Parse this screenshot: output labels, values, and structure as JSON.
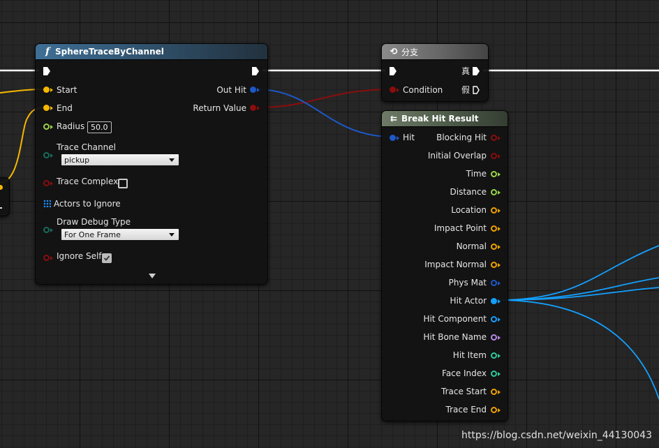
{
  "colors": {
    "exec": "#ffffff",
    "vector": "#f5b800",
    "float": "#9ad34a",
    "bool": "#8b0d0d",
    "struct": "#1e58c8",
    "enum": "#1a6b5c",
    "object": "#14a0ff",
    "name": "#b988e8",
    "teal": "#2ec99a",
    "transform": "#f0a000"
  },
  "sphere_trace": {
    "title": "SphereTraceByChannel",
    "title_icon": "function-icon",
    "pins": {
      "start": "Start",
      "end": "End",
      "radius": "Radius",
      "radius_value": "50.0",
      "trace_channel": "Trace Channel",
      "trace_channel_value": "pickup",
      "trace_complex": "Trace Complex",
      "actors_to_ignore": "Actors to Ignore",
      "draw_debug_type": "Draw Debug Type",
      "draw_debug_value": "For One Frame",
      "ignore_self": "Ignore Self",
      "out_hit": "Out Hit",
      "return_value": "Return Value"
    }
  },
  "branch": {
    "title": "分支",
    "title_icon": "branch-icon",
    "condition": "Condition",
    "true_label": "真",
    "false_label": "假"
  },
  "break_hit": {
    "title": "Break Hit Result",
    "title_icon": "break-struct-icon",
    "input": "Hit",
    "outputs": [
      "Blocking Hit",
      "Initial Overlap",
      "Time",
      "Distance",
      "Location",
      "Impact Point",
      "Normal",
      "Impact Normal",
      "Phys Mat",
      "Hit Actor",
      "Hit Component",
      "Hit Bone Name",
      "Hit Item",
      "Face Index",
      "Trace Start",
      "Trace End"
    ]
  },
  "watermark": "https://blog.csdn.net/weixin_44130043"
}
